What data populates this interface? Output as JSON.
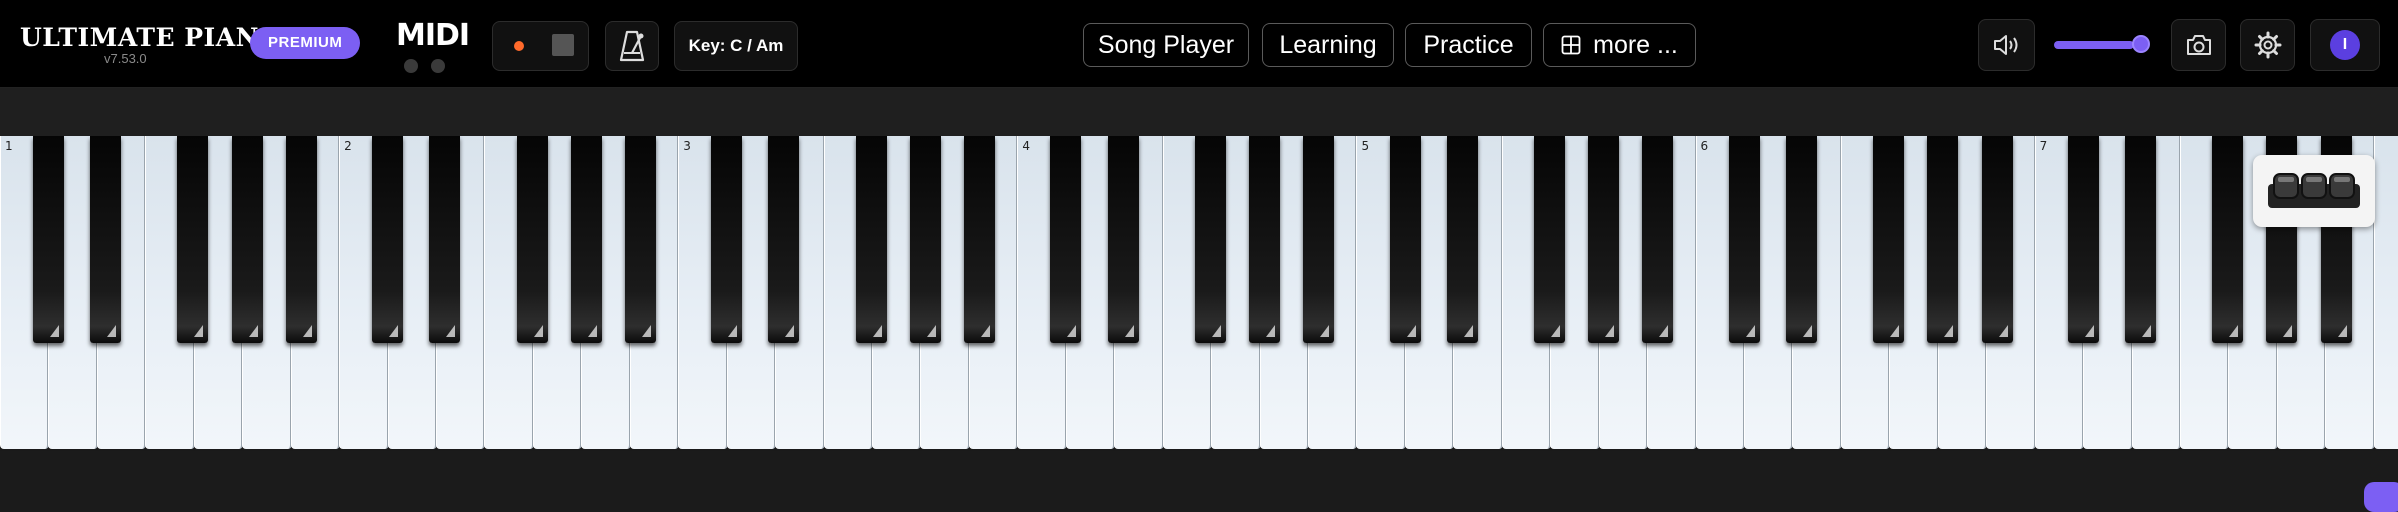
{
  "header": {
    "app_title": "ULTIMATE PIANO",
    "version": "v7.53.0",
    "premium_badge": "PREMIUM",
    "midi_label": "MIDI",
    "key_label": "Key: C / Am",
    "nav": {
      "song_player": "Song Player",
      "learning": "Learning",
      "practice": "Practice",
      "more": "more ..."
    },
    "volume_level": 1.0,
    "avatar_initial": "I"
  },
  "keyboard": {
    "white_key_count": 50,
    "octave_labels": [
      "1",
      "2",
      "3",
      "4",
      "5",
      "6",
      "7"
    ]
  },
  "colors": {
    "accent": "#7c5ff3",
    "record": "#ff6a2b",
    "topbar_bg": "#000000"
  },
  "icons": {
    "metronome": "metronome-icon",
    "more": "grid-icon",
    "volume": "speaker-icon",
    "camera": "camera-icon",
    "settings": "gear-icon",
    "pedal": "piano-pedal-icon"
  }
}
